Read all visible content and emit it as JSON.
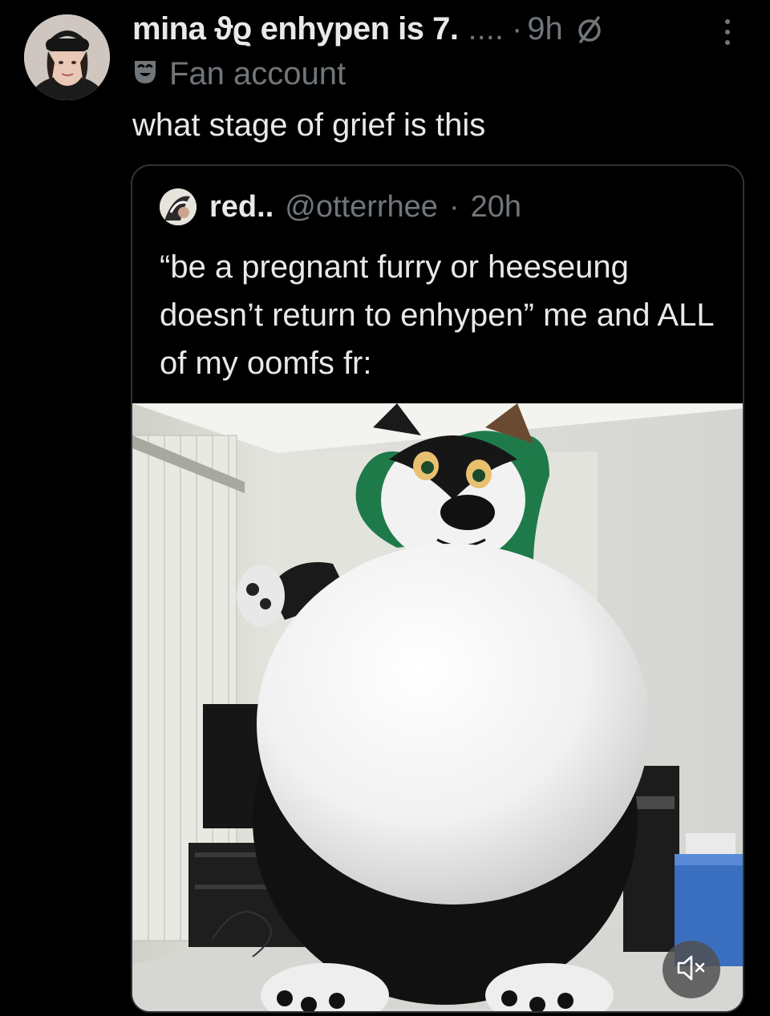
{
  "post": {
    "display_name": "mina ϑϱ enhypen is 7.",
    "ellipsis": "....",
    "separator": "·",
    "time": "9h",
    "label": "Fan account",
    "text": "what stage of grief is this"
  },
  "quote": {
    "display_name": "red..",
    "handle": "@otterrhee",
    "separator": "·",
    "time": "20h",
    "text": "“be a pregnant furry or heeseung doesn’t return to enhypen” me and ALL of my oomfs fr:"
  },
  "media": {
    "mute_icon": "speaker-muted-icon"
  },
  "colors": {
    "background": "#000000",
    "primary_text": "#e7e9ea",
    "secondary_text": "#71767b",
    "border": "#2f3336"
  }
}
